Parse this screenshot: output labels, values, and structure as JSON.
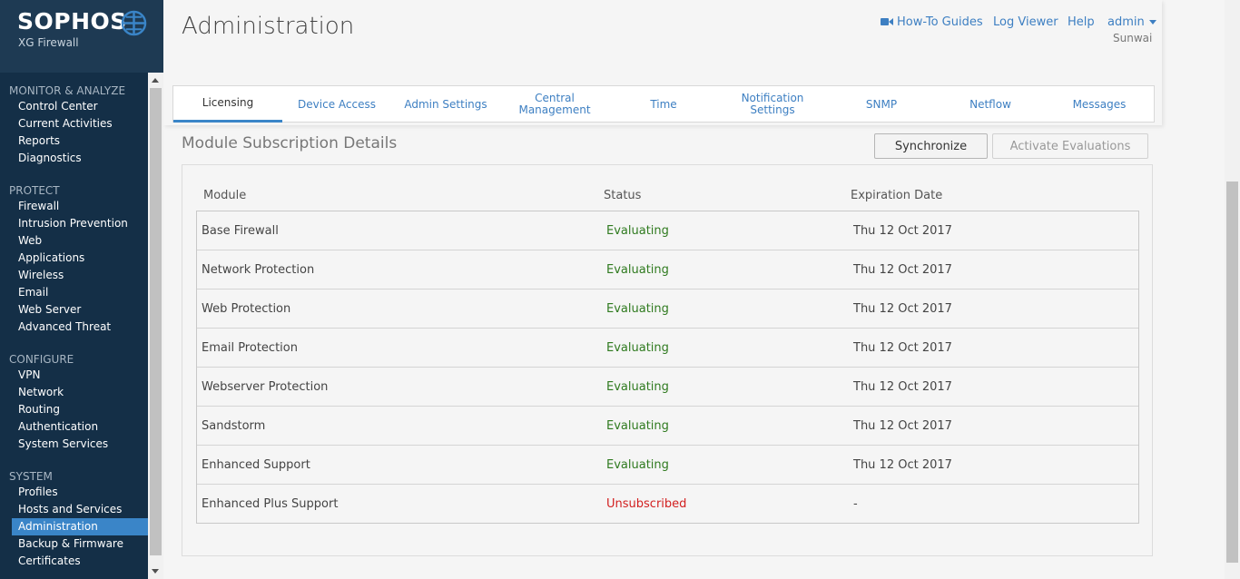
{
  "brand": {
    "name": "SOPHOS",
    "product": "XG Firewall"
  },
  "sidebar": {
    "sections": [
      {
        "title": "MONITOR & ANALYZE",
        "items": [
          "Control Center",
          "Current Activities",
          "Reports",
          "Diagnostics"
        ]
      },
      {
        "title": "PROTECT",
        "items": [
          "Firewall",
          "Intrusion Prevention",
          "Web",
          "Applications",
          "Wireless",
          "Email",
          "Web Server",
          "Advanced Threat"
        ]
      },
      {
        "title": "CONFIGURE",
        "items": [
          "VPN",
          "Network",
          "Routing",
          "Authentication",
          "System Services"
        ]
      },
      {
        "title": "SYSTEM",
        "items": [
          "Profiles",
          "Hosts and Services",
          "Administration",
          "Backup & Firmware",
          "Certificates"
        ]
      }
    ],
    "active_item": "Administration"
  },
  "header": {
    "title": "Administration",
    "links": {
      "howto": "How-To Guides",
      "logviewer": "Log Viewer",
      "help": "Help",
      "user": "admin"
    },
    "user_sub": "Sunwai"
  },
  "tabs": [
    "Licensing",
    "Device Access",
    "Admin Settings",
    "Central Management",
    "Time",
    "Notification Settings",
    "SNMP",
    "Netflow",
    "Messages"
  ],
  "tab_lines": [
    [
      "Licensing"
    ],
    [
      "Device Access"
    ],
    [
      "Admin Settings"
    ],
    [
      "Central",
      "Management"
    ],
    [
      "Time"
    ],
    [
      "Notification",
      "Settings"
    ],
    [
      "SNMP"
    ],
    [
      "Netflow"
    ],
    [
      "Messages"
    ]
  ],
  "active_tab": "Licensing",
  "section": {
    "title": "Module Subscription Details",
    "sync_label": "Synchronize",
    "activate_label": "Activate Evaluations"
  },
  "table": {
    "headers": {
      "module": "Module",
      "status": "Status",
      "expiration": "Expiration Date"
    },
    "rows": [
      {
        "module": "Base Firewall",
        "status": "Evaluating",
        "expiration": "Thu 12 Oct 2017"
      },
      {
        "module": "Network Protection",
        "status": "Evaluating",
        "expiration": "Thu 12 Oct 2017"
      },
      {
        "module": "Web Protection",
        "status": "Evaluating",
        "expiration": "Thu 12 Oct 2017"
      },
      {
        "module": "Email Protection",
        "status": "Evaluating",
        "expiration": "Thu 12 Oct 2017"
      },
      {
        "module": "Webserver Protection",
        "status": "Evaluating",
        "expiration": "Thu 12 Oct 2017"
      },
      {
        "module": "Sandstorm",
        "status": "Evaluating",
        "expiration": "Thu 12 Oct 2017"
      },
      {
        "module": "Enhanced Support",
        "status": "Evaluating",
        "expiration": "Thu 12 Oct 2017"
      },
      {
        "module": "Enhanced Plus Support",
        "status": "Unsubscribed",
        "expiration": "-"
      }
    ]
  },
  "colors": {
    "accent": "#3a85c8",
    "sidebar": "#142f47",
    "ok": "#2f7a1f",
    "bad": "#d21f1f"
  },
  "icons": {
    "globe": "sophos-globe-icon",
    "video": "video-camera-icon"
  }
}
